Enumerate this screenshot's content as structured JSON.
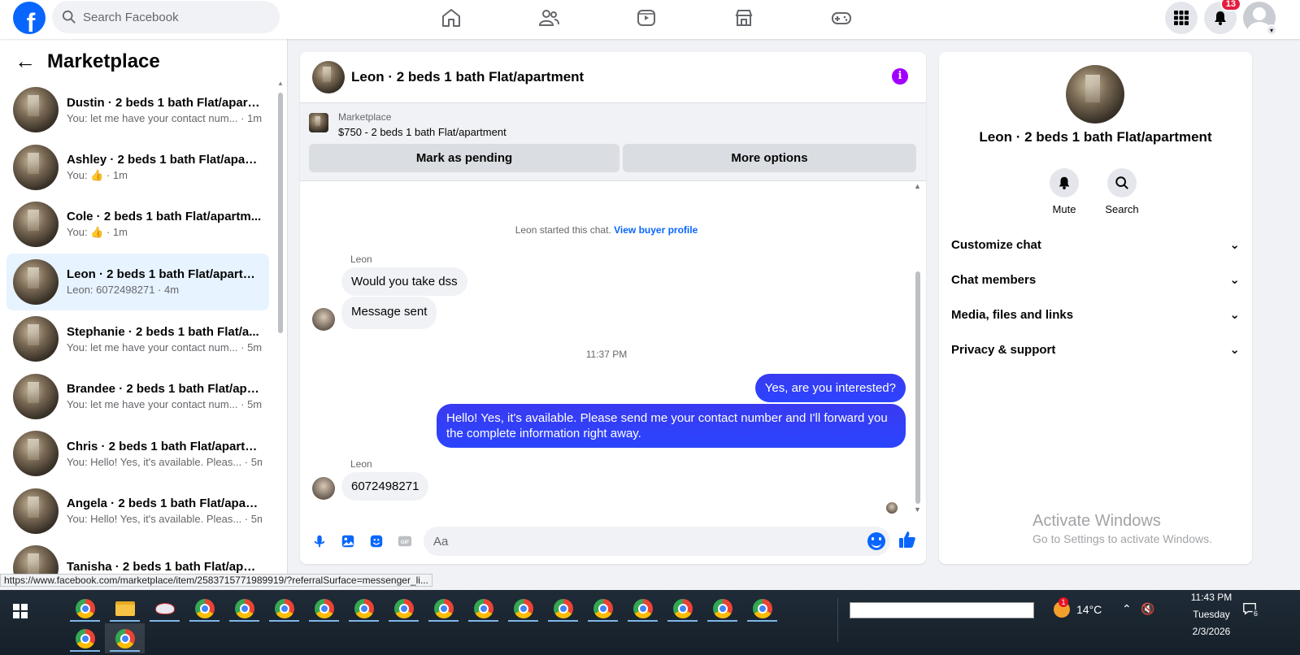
{
  "topnav": {
    "logo": "f",
    "search_placeholder": "Search Facebook",
    "nav_icons": [
      "home-icon",
      "friends-icon",
      "video-icon",
      "marketplace-icon",
      "gaming-icon"
    ],
    "notifications_count": "13"
  },
  "sidebar": {
    "back": "←",
    "title": "Marketplace",
    "conversations": [
      {
        "title": "Dustin · 2 beds 1 bath Flat/apart...",
        "sub": "You: let me have your contact num... · 1m"
      },
      {
        "title": "Ashley · 2 beds 1 bath Flat/apart...",
        "sub": "You: 👍 · 1m"
      },
      {
        "title": "Cole · 2 beds 1 bath Flat/apartm...",
        "sub": "You: 👍 · 1m"
      },
      {
        "title": "Leon · 2 beds 1 bath Flat/apartm...",
        "sub": "Leon: 6072498271 · 4m"
      },
      {
        "title": "Stephanie · 2 beds 1 bath Flat/a...",
        "sub": "You: let me have your contact num... · 5m"
      },
      {
        "title": "Brandee · 2 beds 1 bath Flat/apa...",
        "sub": "You: let me have your contact num... · 5m"
      },
      {
        "title": "Chris · 2 beds 1 bath Flat/apartm...",
        "sub": "You: Hello! Yes, it's available. Pleas... · 5m"
      },
      {
        "title": "Angela · 2 beds 1 bath Flat/apart...",
        "sub": "You: Hello! Yes, it's available. Pleas... · 5m"
      },
      {
        "title": "Tanisha · 2 beds 1 bath Flat/apar...",
        "sub": ""
      }
    ]
  },
  "chat": {
    "title": "Leon · 2 beds 1 bath Flat/apartment",
    "listing_source": "Marketplace",
    "listing_title": "$750 - 2 beds 1 bath Flat/apartment",
    "mark_pending": "Mark as pending",
    "more_options": "More options",
    "started_text": "Leon started this chat.",
    "view_buyer": "View buyer profile",
    "sender1": "Leon",
    "msg1": "Would you take dss",
    "msg2": "Message sent",
    "time": "11:37 PM",
    "out1": "Yes, are you interested?",
    "out2": "Hello! Yes, it's available. Please send me your contact number and I'll forward you the complete information right away.",
    "sender2": "Leon",
    "msg3": "6072498271",
    "input_placeholder": "Aa"
  },
  "info": {
    "name": "Leon · 2 beds 1 bath Flat/apartment",
    "mute": "Mute",
    "search": "Search",
    "sections": [
      "Customize chat",
      "Chat members",
      "Media, files and links",
      "Privacy & support"
    ],
    "watermark_1": "Activate Windows",
    "watermark_2": "Go to Settings to activate Windows."
  },
  "status_url": "https://www.facebook.com/marketplace/item/2583715771989919/?referralSurface=messenger_li...",
  "taskbar": {
    "temperature": "14°C",
    "weather_badge": "1",
    "time": "11:43 PM",
    "day": "Tuesday",
    "date": "2/3/2026",
    "notif_count": "6"
  }
}
